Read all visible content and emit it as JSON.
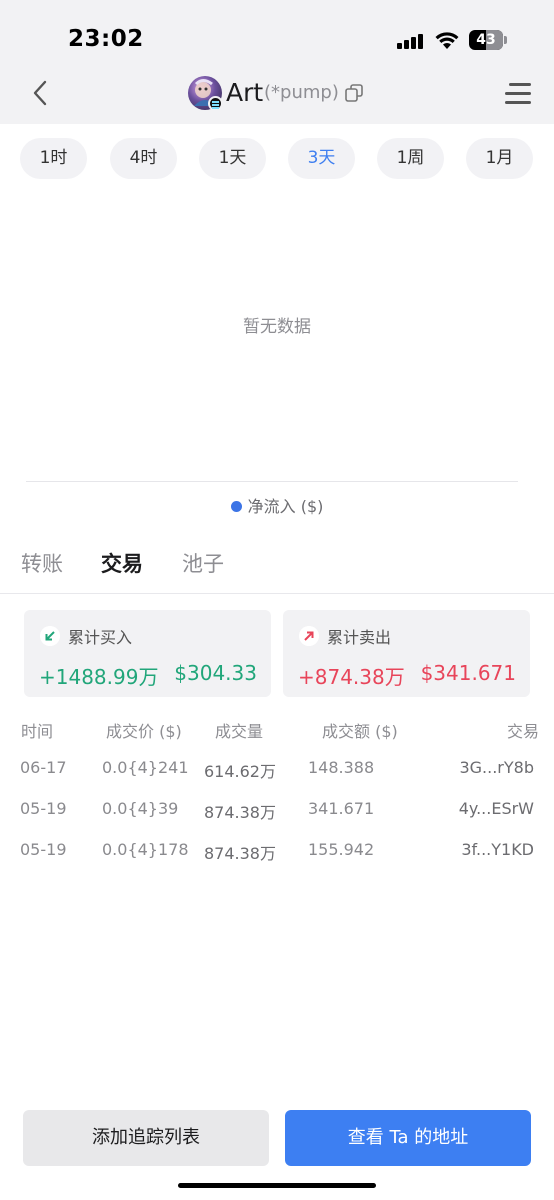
{
  "status_bar": {
    "time": "23:02",
    "battery": "43"
  },
  "nav": {
    "title": "Art",
    "subtitle": "(*pump)"
  },
  "ranges": [
    {
      "label": "1时",
      "active": false
    },
    {
      "label": "4时",
      "active": false
    },
    {
      "label": "1天",
      "active": false
    },
    {
      "label": "3天",
      "active": true
    },
    {
      "label": "1周",
      "active": false
    },
    {
      "label": "1月",
      "active": false
    }
  ],
  "chart": {
    "empty_text": "暂无数据",
    "legend": "净流入 ($)",
    "legend_color": "#3c74e6"
  },
  "section_tabs": [
    {
      "label": "转账",
      "active": false
    },
    {
      "label": "交易",
      "active": true
    },
    {
      "label": "池子",
      "active": false
    }
  ],
  "summary": {
    "buy": {
      "label": "累计买入",
      "amount": "+1488.99万",
      "usd": "$304.33"
    },
    "sell": {
      "label": "累计卖出",
      "amount": "+874.38万",
      "usd": "$341.671"
    }
  },
  "table": {
    "headers": [
      "时间",
      "成交价 ($)",
      "成交量",
      "成交额 ($)",
      "交易"
    ],
    "rows": [
      {
        "time": "06-17",
        "price": "0.0{4}241",
        "side": "buy",
        "volume": "614.62万",
        "value": "148.388",
        "tx": "3G...rY8b"
      },
      {
        "time": "05-19",
        "price": "0.0{4}39",
        "side": "sell",
        "volume": "874.38万",
        "value": "341.671",
        "tx": "4y...ESrW"
      },
      {
        "time": "05-19",
        "price": "0.0{4}178",
        "side": "buy",
        "volume": "874.38万",
        "value": "155.942",
        "tx": "3f...Y1KD"
      }
    ]
  },
  "colors": {
    "buy": "#21a67a",
    "sell": "#e8455a",
    "accent": "#3d7ff2"
  },
  "buttons": {
    "track": "添加追踪列表",
    "view_address": "查看 Ta 的地址"
  }
}
